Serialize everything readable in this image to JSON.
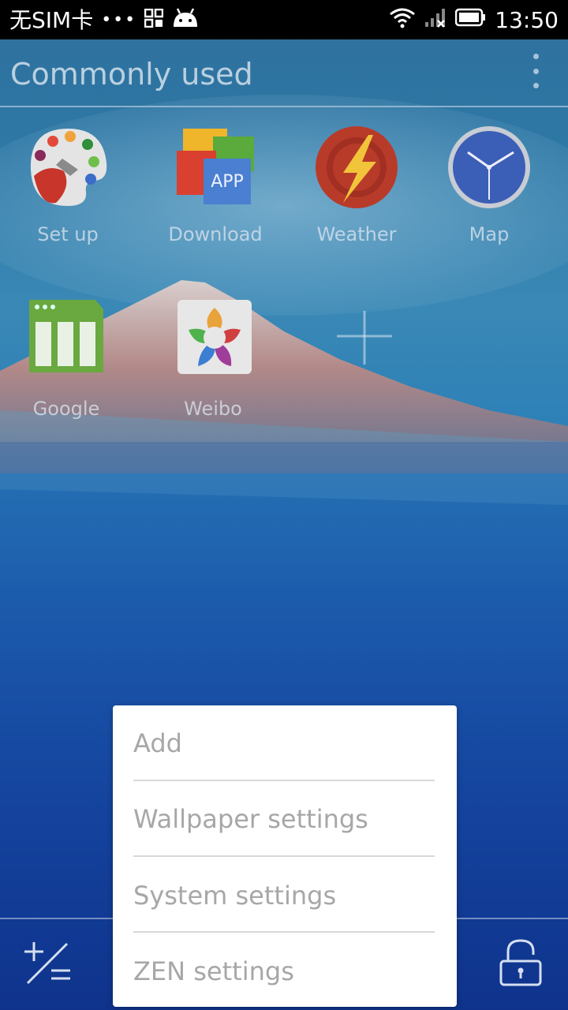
{
  "status_bar": {
    "carrier": "无SIM卡",
    "dots": "•••",
    "time": "13:50"
  },
  "header": {
    "title": "Commonly used",
    "menu_icon": "more-vertical-icon"
  },
  "apps": [
    {
      "label": "Set up",
      "icon": "palette-icon"
    },
    {
      "label": "Download",
      "icon": "app-store-icon",
      "icon_text": "APP"
    },
    {
      "label": "Weather",
      "icon": "lightning-gear-icon"
    },
    {
      "label": "Map",
      "icon": "clock-icon"
    },
    {
      "label": "Google",
      "icon": "green-grid-icon"
    },
    {
      "label": "Weibo",
      "icon": "flower-camera-icon"
    },
    {
      "label": "",
      "icon": "add-plus-icon"
    }
  ],
  "dock": {
    "left_icon": "plus-minus-icon",
    "right_icon": "unlock-icon"
  },
  "menu": {
    "items": [
      "Add",
      "Wallpaper settings",
      "System settings",
      "ZEN settings"
    ]
  },
  "colors": {
    "menu_bg": "#ffffff",
    "menu_text": "#a7a7a7",
    "statusbar_bg": "#000000"
  }
}
